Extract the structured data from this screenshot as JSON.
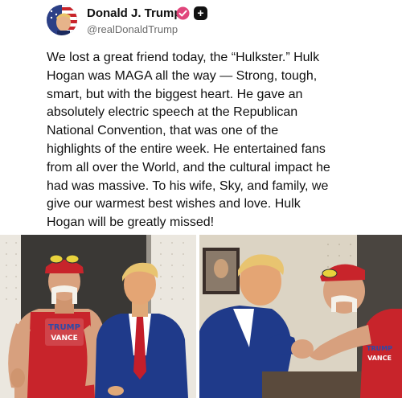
{
  "post": {
    "author": {
      "display_name": "Donald J. Trump",
      "handle": "@realDonaldTrump",
      "verified_icon": "verified-badge-icon",
      "plus_label": "+"
    },
    "body": "We lost a great friend today, the “Hulkster.” Hulk\nHogan was MAGA all the way — Strong, tough,\nsmart, but with the biggest heart. He gave an\nabsolutely electric speech at the Republican\nNational Convention, that was one of the\nhighlights of the entire week. He entertained fans\nfrom all over the World, and the cultural impact he\nhad was massive. To his wife, Sky, and family, we\ngive our warmest best wishes and love. Hulk\nHogan will be greatly missed!",
    "photos": [
      {
        "shirt_text_line1": "TRUMP",
        "shirt_text_line2": "VANCE"
      },
      {
        "shirt_text_line1": "TRUMP",
        "shirt_text_line2": "VANCE"
      }
    ]
  },
  "colors": {
    "verified": "#e0457b",
    "shirt_red": "#c8242b",
    "suit_blue": "#1f3a8a",
    "tie_red": "#c41e2a"
  }
}
